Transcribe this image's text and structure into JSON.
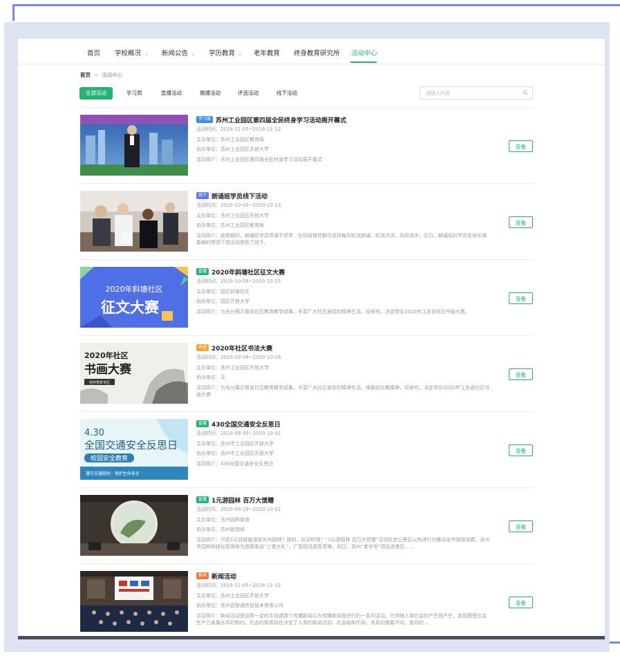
{
  "nav": {
    "items": [
      {
        "label": "首页",
        "has_dropdown": false
      },
      {
        "label": "学校概况",
        "has_dropdown": true
      },
      {
        "label": "新闻公告",
        "has_dropdown": true
      },
      {
        "label": "学历教育",
        "has_dropdown": true
      },
      {
        "label": "老年教育",
        "has_dropdown": false
      },
      {
        "label": "终身教育研究所",
        "has_dropdown": false
      },
      {
        "label": "活动中心",
        "has_dropdown": false,
        "active": true
      }
    ]
  },
  "breadcrumb": {
    "home": "首页",
    "separator": ">",
    "current": "活动中心"
  },
  "filters": [
    "全部活动",
    "学习周",
    "直播活动",
    "展播活动",
    "评选活动",
    "线下活动"
  ],
  "search": {
    "placeholder": "请输入内容"
  },
  "accent_color": "#25b373",
  "view_label": "查看",
  "activities": [
    {
      "tag": "学习周",
      "tag_color": "#3a8ee6",
      "title": "苏州工业园区第四届全民终身学习活动周开幕式",
      "time": "活动时间：2018-11-05~2018-11-12",
      "host": "主办单位：苏州工业园区教育局",
      "co_host": "协办单位：苏州工业园区开放大学",
      "intro": "活动简介：苏州工业园区第四届全民终身学习活动周开幕式",
      "image": "speaker-on-stage-city-skyline"
    },
    {
      "tag": "线下",
      "tag_color": "#5b7cf0",
      "title": "朗诵班学员线下活动",
      "time": "活动时间：2020-10-05~2020-10-13",
      "host": "主办单位：苏州工业园区开放大学",
      "co_host": "协办单位：苏州工业园区教育局",
      "intro": "活动简介：疫情期间，朗诵班学员停课不停学，在班级微信群中坚持每天轮流朗诵、轮流点评，共同进步。近日，朗诵班的学员在班长骑春梅的带领下把活动带到了线下。",
      "image": "group-reading-photo"
    },
    {
      "tag": "直播",
      "tag_color": "#25b373",
      "title": "2020年斜塘社区征文大赛",
      "time": "活动时间：2020-10-09~2020-10-15",
      "host": "主办单位：园区斜塘社区",
      "co_host": "协办单位：园区开放大学",
      "intro": "活动简介：为充分展示我省社区教育教学成果，丰富广大社区居民的精神生活，经研究，决定举办2020年江苏省社区书画大赛。",
      "image": "essay-contest-poster",
      "poster_line1": "2020年斜塘社区",
      "poster_line2": "征文大赛"
    },
    {
      "tag": "评选",
      "tag_color": "#f0a63a",
      "title": "2020年社区书法大赛",
      "time": "活动时间：2020-10-08~2020-10-16",
      "host": "主办单位：苏州工业园区开放大学",
      "co_host": "协办单位：无",
      "intro": "活动简介：为充分展示我省社区教育教学成果，丰富广大社区居民的精神生活，根据苏社教精神，经研究，决定举办2020年江苏省社区书画大赛",
      "image": "calligraphy-contest-poster",
      "poster_line1": "2020年社区",
      "poster_line2": "书画大赛",
      "poster_button": "佳作赏析专区"
    },
    {
      "tag": "直播",
      "tag_color": "#25b373",
      "title": "430全国交通安全反思日",
      "time": "活动时间：2020-09-30~2020-10-31",
      "host": "主办单位：苏州市工业园区开放大学",
      "co_host": "协办单位：苏州市工业园区开放大学",
      "intro": "活动简介：430全国交通安全反思日",
      "image": "traffic-safety-poster",
      "poster_line1": "4.30",
      "poster_line2": "全国交通安全反思日",
      "poster_badge": "校园安全教育",
      "poster_line3": "遵守交通规则 · 保护生命安全"
    },
    {
      "tag": "直播",
      "tag_color": "#25b373",
      "title": "1元游园林 百万大馈赠",
      "time": "活动时间：2020-09-29~2020-10-31",
      "host": "主办单位：苏州园林旅游",
      "co_host": "协办单位：苏州旅游局",
      "intro": "活动简介：只花1元钱就能游览苏州园林？是的，你没听错！“1元游园林 百万大馈赠”活动在虎丘景区火热进行为推动全市旅游消费，苏州市园林和绿化管理局为游客奉送“三重大礼”，广受现场游客青睐。同日，苏州“老字号”项目进景区、...",
      "image": "garden-moon-gate-photo"
    },
    {
      "tag": "新闻",
      "tag_color": "#f07a3a",
      "title": "新闻活动",
      "time": "活动时间：2018-11-05~2018-11-12",
      "host": "主办单位：苏州工业园区开放大学",
      "co_host": "协办单位：苏州百智通信息技术有限公司",
      "intro": "活动简介：新闻活动是运用一定的手段或媒介传播新闻以为传播新闻而进行的一系列活动。它伴随人类社会的产生而产生，其规模受社会生产力发展水平的制约。社会的客观存在决定了人类的新闻活动，社会结构不同，关系的需要不同，变动的...",
      "image": "conference-hall-photo"
    }
  ]
}
